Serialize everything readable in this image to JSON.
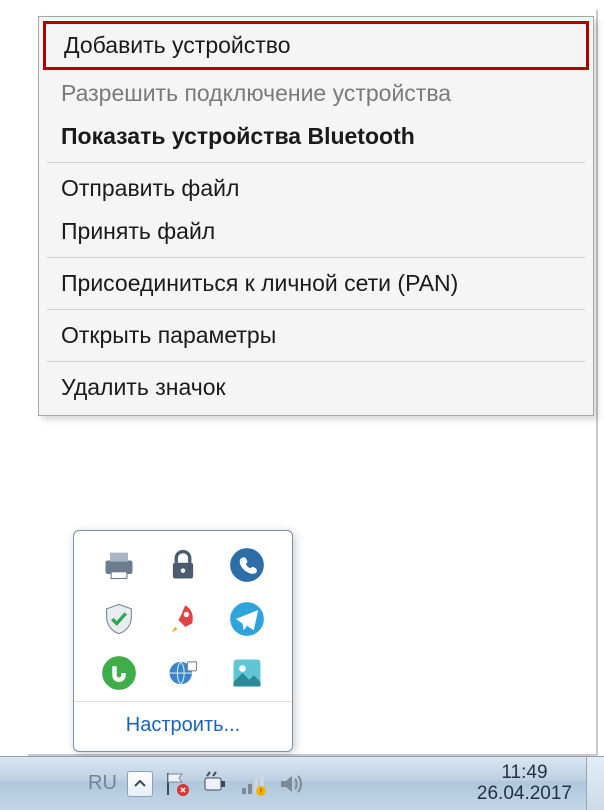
{
  "menu": {
    "add_device": "Добавить устройство",
    "allow_connect": "Разрешить подключение устройства",
    "show_bt": "Показать устройства Bluetooth",
    "send_file": "Отправить файл",
    "receive_file": "Принять файл",
    "join_pan": "Присоединиться к личной сети (PAN)",
    "open_settings": "Открыть параметры",
    "remove_icon": "Удалить значок"
  },
  "tray": {
    "customize": "Настроить...",
    "icons": [
      "printer-icon",
      "padlock-icon",
      "viber-icon",
      "shield-check-icon",
      "rocket-icon",
      "telegram-icon",
      "utorrent-icon",
      "globe-icon",
      "picasa-icon"
    ]
  },
  "taskbar": {
    "lang": "RU",
    "time": "11:49",
    "date": "26.04.2017",
    "tray_icons": [
      "flag-icon",
      "power-icon",
      "network-icon",
      "volume-icon"
    ]
  }
}
